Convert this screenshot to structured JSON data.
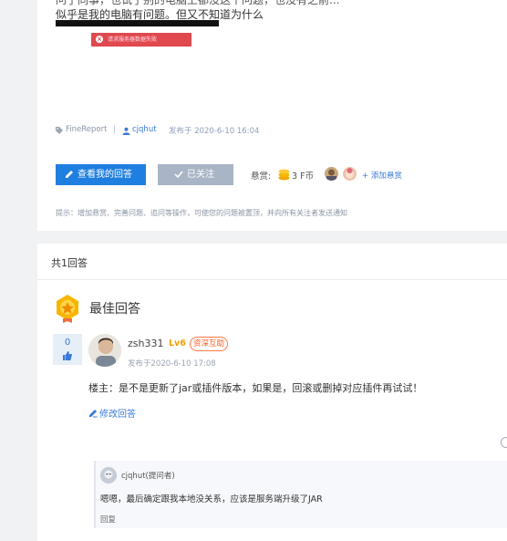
{
  "question": {
    "text_line1": "问了同事，也试了别的电脑上都没这个问题，也没有之前...",
    "text_line2": "似乎是我的电脑有问题。但又不知道为什么",
    "error_image_text": "请求服务器数据失败",
    "tag": "FineReport",
    "author": "cjqhut",
    "posted_at": "发布于 2020-6-10 16:04",
    "buttons": {
      "view_answer": "查看我的回答",
      "followed": "已关注"
    },
    "bounty_label": "悬赏:",
    "bounty_amount": "3 F币",
    "add_bounty": "+ 添加悬赏",
    "hint": "提示：增加悬赏、完善问题、追问等操作，可使您的问题被置顶，并向所有关注者发送通知"
  },
  "answers": {
    "count_label": "共1回答",
    "best_title": "最佳回答",
    "best": {
      "votes": "0",
      "user": "zsh331",
      "level": "Lv6",
      "badge": "资深互助",
      "time": "发布于2020-6-10 17:08",
      "body": "楼主：是不是更新了jar或插件版本，如果是，回滚或删掉对应插件再试试！",
      "edit_label": "修改回答"
    },
    "comment": {
      "user": "cjqhut(提问者)",
      "text": "嗯嗯，最后确定跟我本地没关系，应该是服务端升级了JAR",
      "reply_label": "回复"
    }
  },
  "colors": {
    "primary": "#1f7fe0",
    "link": "#3a7bd5",
    "badge": "#ff5a1f",
    "level": "#f0a000"
  }
}
